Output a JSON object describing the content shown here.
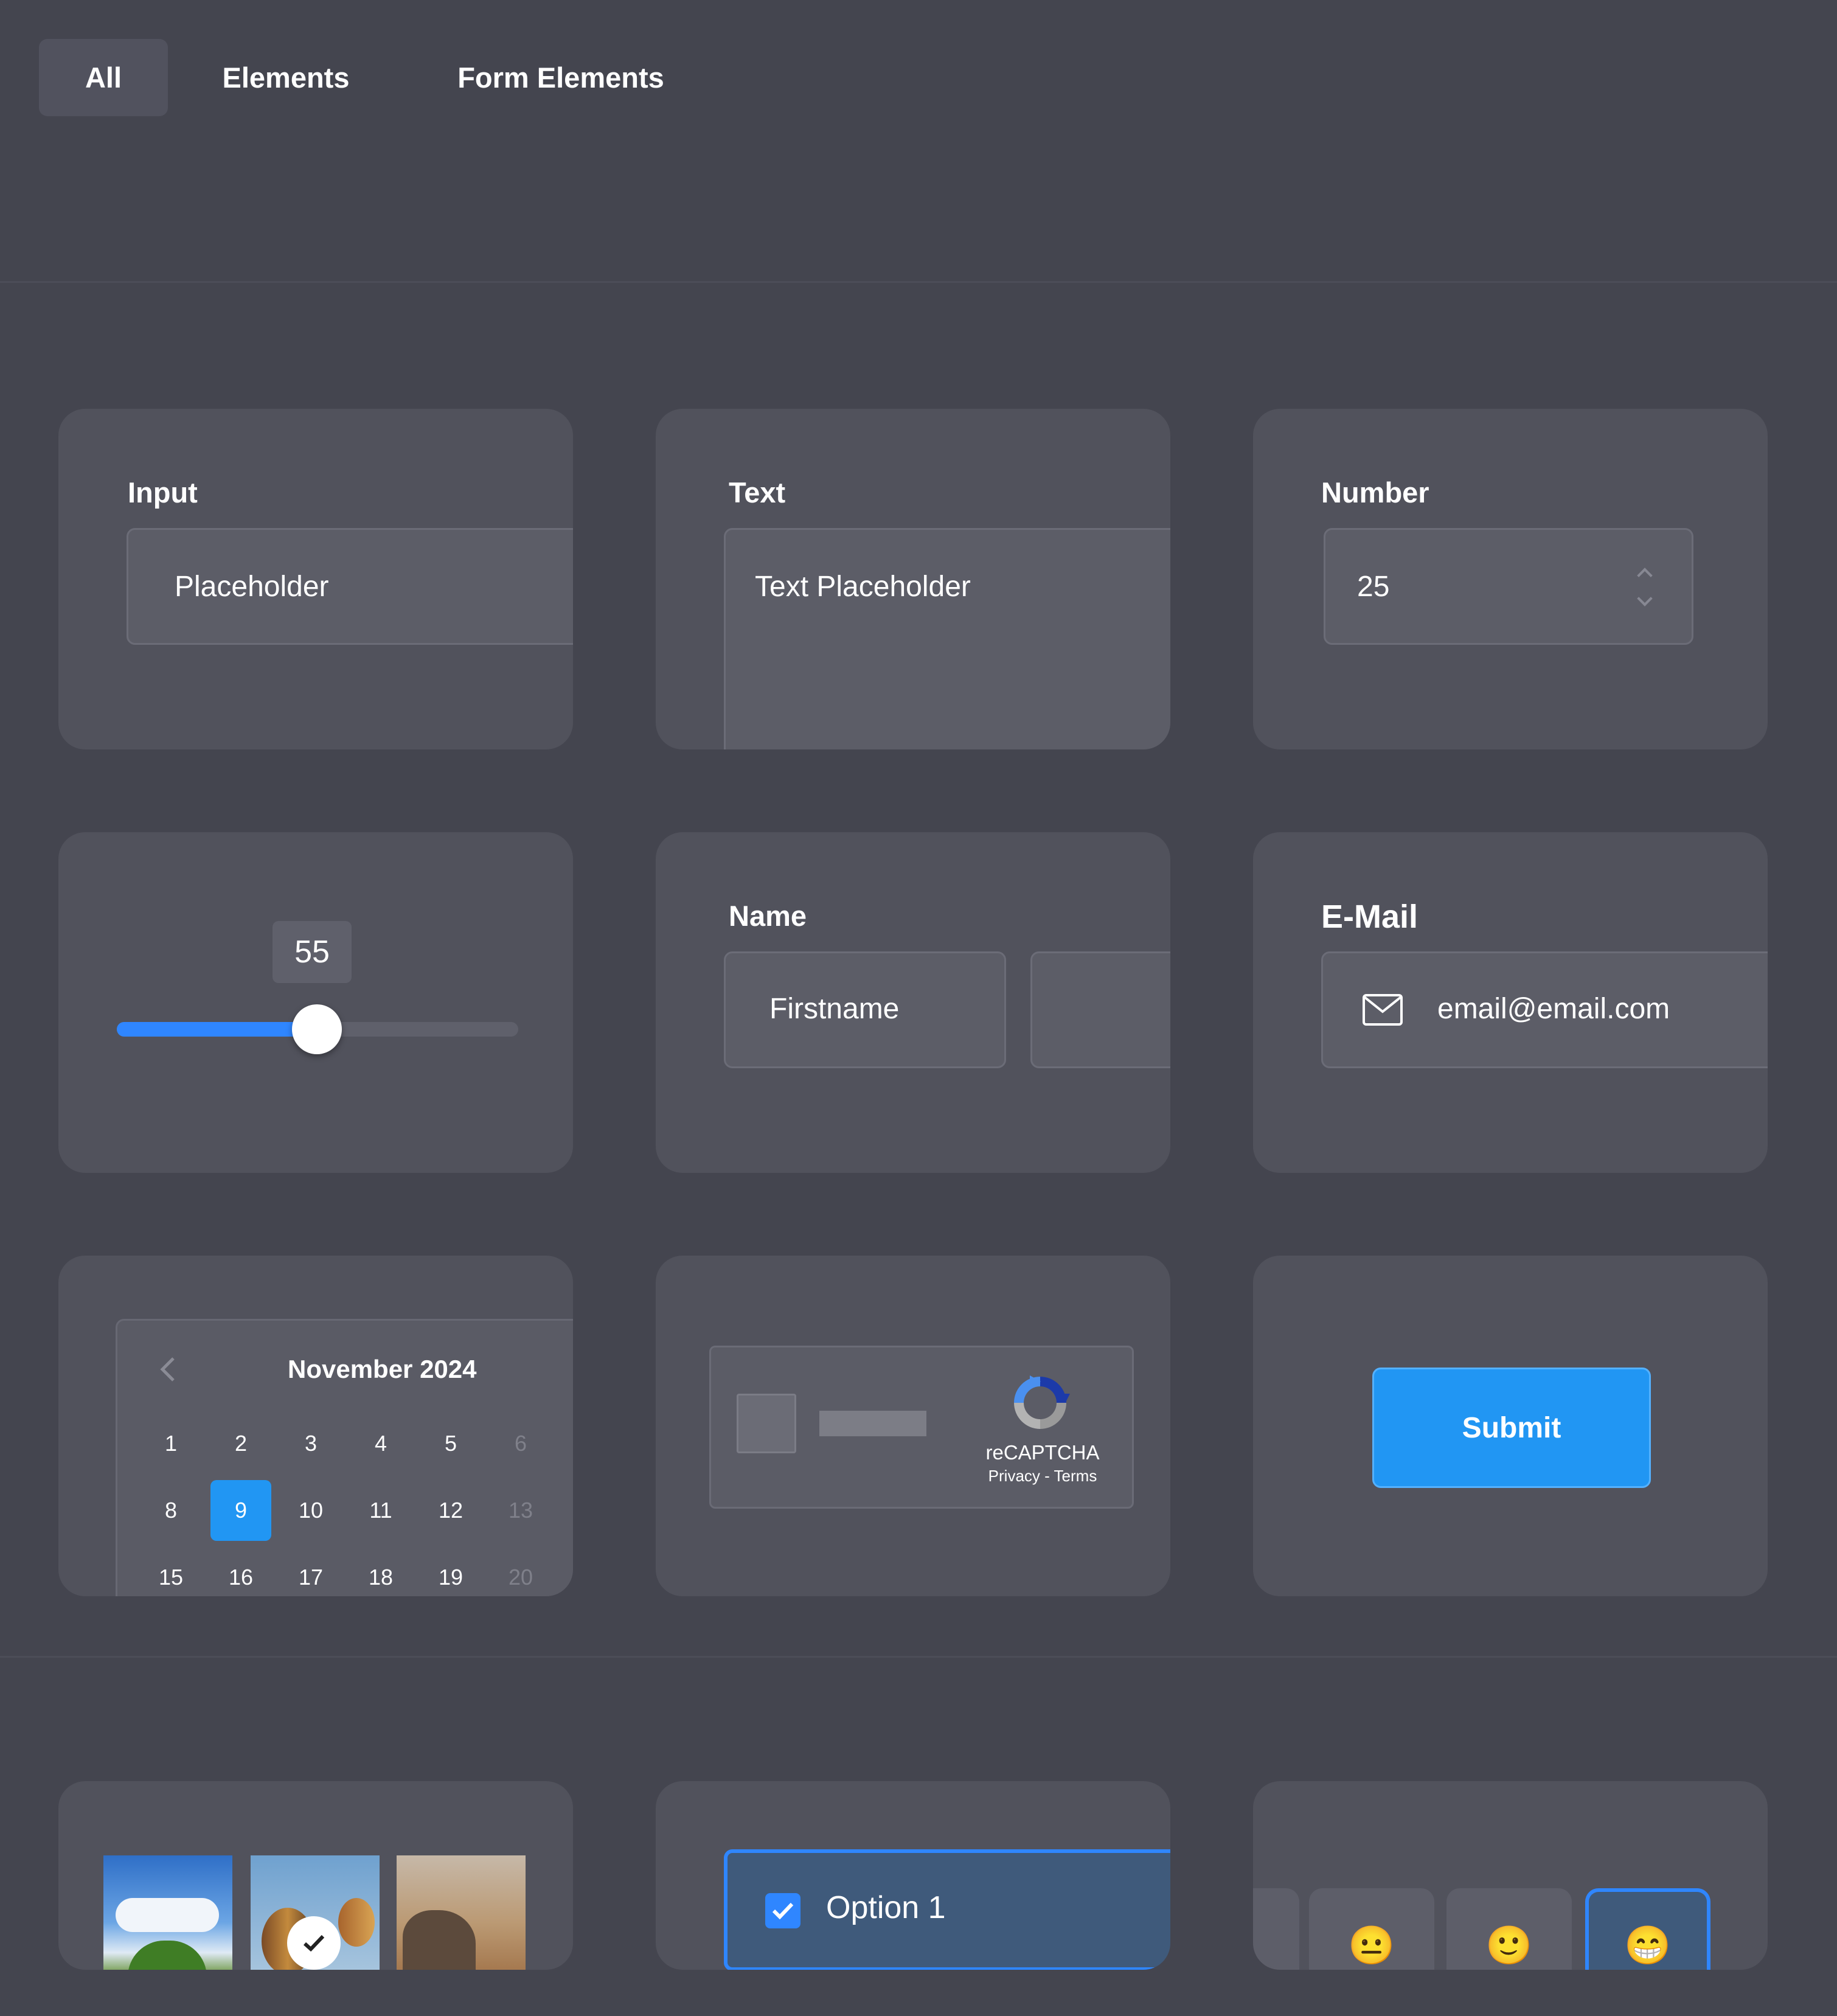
{
  "tabs": [
    {
      "label": "All",
      "active": true
    },
    {
      "label": "Elements",
      "active": false
    },
    {
      "label": "Form Elements",
      "active": false
    }
  ],
  "input_card": {
    "label": "Input",
    "placeholder": "Placeholder"
  },
  "text_card": {
    "label": "Text",
    "placeholder": "Text Placeholder"
  },
  "number_card": {
    "label": "Number",
    "value": "25"
  },
  "slider_card": {
    "value": "55",
    "fraction": 0.55
  },
  "name_card": {
    "label": "Name",
    "first_placeholder": "Firstname"
  },
  "email_card": {
    "label": "E-Mail",
    "placeholder": "email@email.com",
    "icon": "envelope-icon"
  },
  "calendar_card": {
    "month": "November 2024",
    "selected": "9",
    "rows": [
      [
        "1",
        "2",
        "3",
        "4",
        "5",
        "6"
      ],
      [
        "8",
        "9",
        "10",
        "11",
        "12",
        "13"
      ],
      [
        "15",
        "16",
        "17",
        "18",
        "19",
        "20"
      ]
    ]
  },
  "captcha_card": {
    "brand": "reCAPTCHA",
    "links": "Privacy - Terms"
  },
  "submit_card": {
    "label": "Submit"
  },
  "image_select_card": {
    "images": [
      "sky-tree-image",
      "hot-air-balloon-image",
      "desert-rock-image"
    ],
    "selected_index": 1
  },
  "option_card": {
    "label": "Option 1",
    "checked": true
  },
  "rating_card": {
    "emojis": [
      "😐",
      "🙂",
      "😁"
    ],
    "selected_index": 2
  },
  "colors": {
    "accent": "#2196f3",
    "bg": "#44454f",
    "card": "#51525c",
    "field": "#5c5d67"
  }
}
